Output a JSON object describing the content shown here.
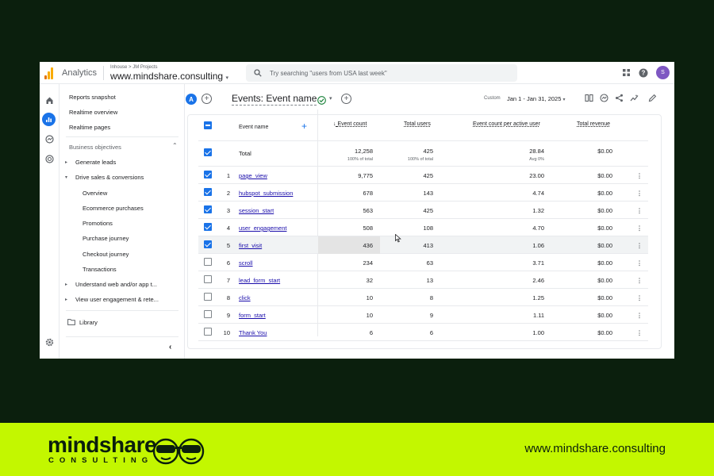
{
  "header": {
    "app_title": "Analytics",
    "breadcrumb": "Inhouse > JM Projects",
    "property_name": "www.mindshare.consulting",
    "search_placeholder": "Try searching \"users from USA last week\"",
    "avatar_letter": "S"
  },
  "nav": {
    "top_items": [
      "Reports snapshot",
      "Realtime overview",
      "Realtime pages"
    ],
    "section_label": "Business objectives",
    "groups": [
      "Generate leads",
      "Drive sales & conversions",
      "Understand web and/or app t...",
      "View user engagement & rete..."
    ],
    "sub_items": [
      "Overview",
      "Ecommerce purchases",
      "Promotions",
      "Purchase journey",
      "Checkout journey",
      "Transactions"
    ],
    "library_label": "Library"
  },
  "report": {
    "comparison_badge": "A",
    "title": "Events: Event name",
    "date_label": "Custom",
    "date_range": "Jan 1 - Jan 31, 2025"
  },
  "table": {
    "columns": [
      "Event name",
      "Event count",
      "Total users",
      "Event count per active user",
      "Total revenue"
    ],
    "total": {
      "label": "Total",
      "event_count": "12,258",
      "event_count_sub": "100% of total",
      "total_users": "425",
      "total_users_sub": "100% of total",
      "per_user": "28.84",
      "per_user_sub": "Avg 0%",
      "revenue": "$0.00"
    },
    "rows": [
      {
        "idx": "1",
        "name": "page_view",
        "count": "9,775",
        "users": "425",
        "per_user": "23.00",
        "revenue": "$0.00",
        "checked": true
      },
      {
        "idx": "2",
        "name": "hubspot_submission",
        "count": "678",
        "users": "143",
        "per_user": "4.74",
        "revenue": "$0.00",
        "checked": true
      },
      {
        "idx": "3",
        "name": "session_start",
        "count": "563",
        "users": "425",
        "per_user": "1.32",
        "revenue": "$0.00",
        "checked": true
      },
      {
        "idx": "4",
        "name": "user_engagement",
        "count": "508",
        "users": "108",
        "per_user": "4.70",
        "revenue": "$0.00",
        "checked": true
      },
      {
        "idx": "5",
        "name": "first_visit",
        "count": "436",
        "users": "413",
        "per_user": "1.06",
        "revenue": "$0.00",
        "checked": true
      },
      {
        "idx": "6",
        "name": "scroll",
        "count": "234",
        "users": "63",
        "per_user": "3.71",
        "revenue": "$0.00",
        "checked": false
      },
      {
        "idx": "7",
        "name": "lead_form_start",
        "count": "32",
        "users": "13",
        "per_user": "2.46",
        "revenue": "$0.00",
        "checked": false
      },
      {
        "idx": "8",
        "name": "click",
        "count": "10",
        "users": "8",
        "per_user": "1.25",
        "revenue": "$0.00",
        "checked": false
      },
      {
        "idx": "9",
        "name": "form_start",
        "count": "10",
        "users": "9",
        "per_user": "1.11",
        "revenue": "$0.00",
        "checked": false
      },
      {
        "idx": "10",
        "name": "Thank You",
        "count": "6",
        "users": "6",
        "per_user": "1.00",
        "revenue": "$0.00",
        "checked": false
      }
    ]
  },
  "footer": {
    "brand_name": "mindshare",
    "brand_sub": "CONSULTING",
    "website": "www.mindshare.consulting"
  },
  "colors": {
    "page_bg": "#0b1f0d",
    "footer_bg": "#c3f700",
    "accent": "#1a73e8"
  }
}
